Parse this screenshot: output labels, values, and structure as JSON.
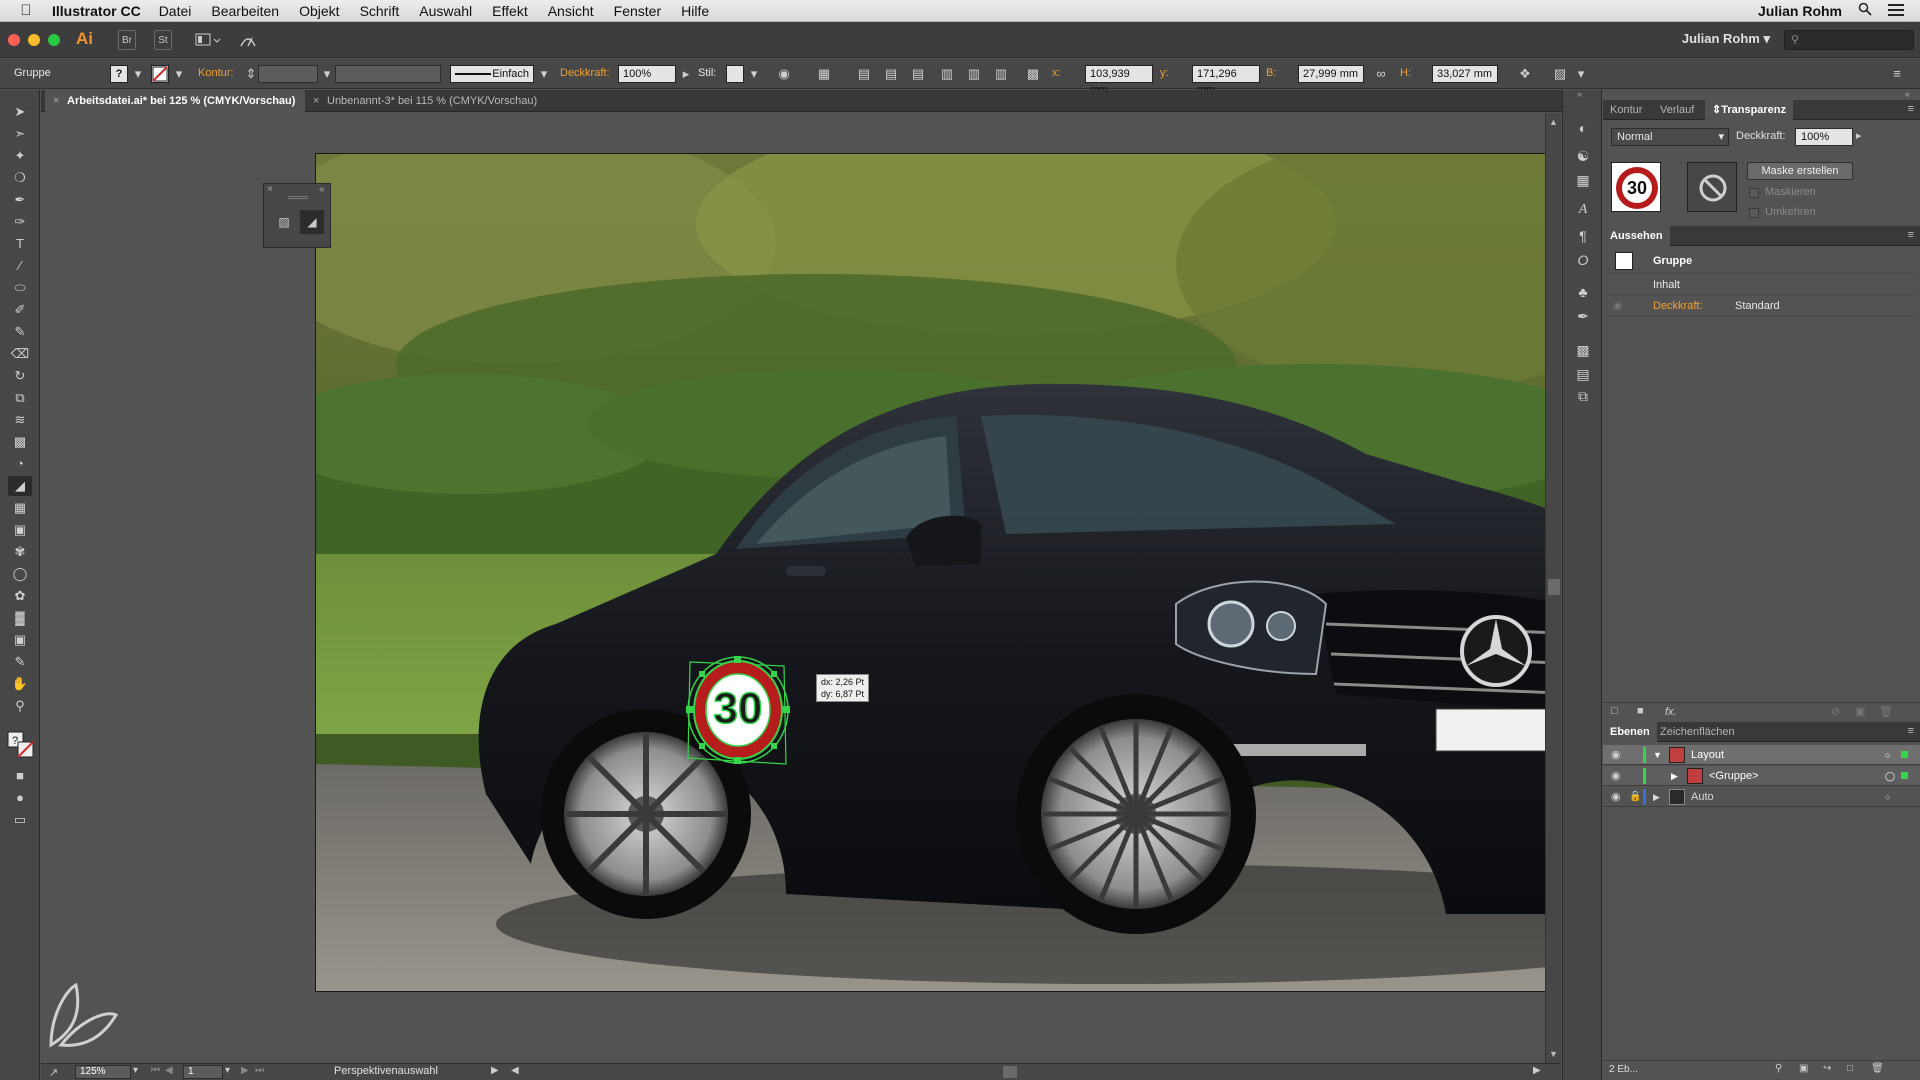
{
  "menubar": {
    "app_name": "Illustrator CC",
    "items": [
      "Datei",
      "Bearbeiten",
      "Objekt",
      "Schrift",
      "Auswahl",
      "Effekt",
      "Ansicht",
      "Fenster",
      "Hilfe"
    ],
    "user": "Julian Rohm"
  },
  "appbar": {
    "logo": "Ai",
    "bridge": "Br",
    "stock": "St",
    "workspace_user": "Julian Rohm"
  },
  "controlbar": {
    "selection_type": "Gruppe",
    "kontur_label": "Kontur:",
    "stroke_style": "Einfach",
    "deckkraft_label": "Deckkraft:",
    "deckkraft_value": "100%",
    "stil_label": "Stil:",
    "x_label": "x:",
    "x_value": "103,939 mm",
    "y_label": "y:",
    "y_value": "171,296 mm",
    "b_label": "B:",
    "b_value": "27,999 mm",
    "h_label": "H:",
    "h_value": "33,027 mm"
  },
  "tabs": [
    {
      "label": "Arbeitsdatei.ai* bei 125 % (CMYK/Vorschau)"
    },
    {
      "label": "Unbenannt-3* bei 115 % (CMYK/Vorschau)"
    }
  ],
  "canvas": {
    "sign_number": "30",
    "tooltip_dx": "dx: 2,26 Pt",
    "tooltip_dy": "dy: 6,87 Pt"
  },
  "status": {
    "zoom": "125%",
    "artboard": "1",
    "tool_name": "Perspektivenauswahl"
  },
  "transparency_panel": {
    "tabs": [
      "Kontur",
      "Verlauf",
      "Transparenz"
    ],
    "blend_mode": "Normal",
    "deckkraft_label": "Deckkraft:",
    "deckkraft_value": "100%",
    "thumb_number": "30",
    "mask_button": "Maske erstellen",
    "maskieren": "Maskieren",
    "umkehren": "Umkehren"
  },
  "appearance_panel": {
    "title": "Aussehen",
    "group_label": "Gruppe",
    "content_label": "Inhalt",
    "opacity_label": "Deckkraft:",
    "opacity_value": "Standard",
    "fx": "fx."
  },
  "layers_panel": {
    "tabs": [
      "Ebenen",
      "Zeichenflächen"
    ],
    "layers": [
      {
        "name": "Layout"
      },
      {
        "name": "<Gruppe>"
      },
      {
        "name": "Auto"
      }
    ],
    "count": "2 Eb..."
  },
  "colors": {
    "accent_orange": "#f0a030",
    "sign_red": "#b71c1c",
    "selection_green": "#35d44a"
  }
}
